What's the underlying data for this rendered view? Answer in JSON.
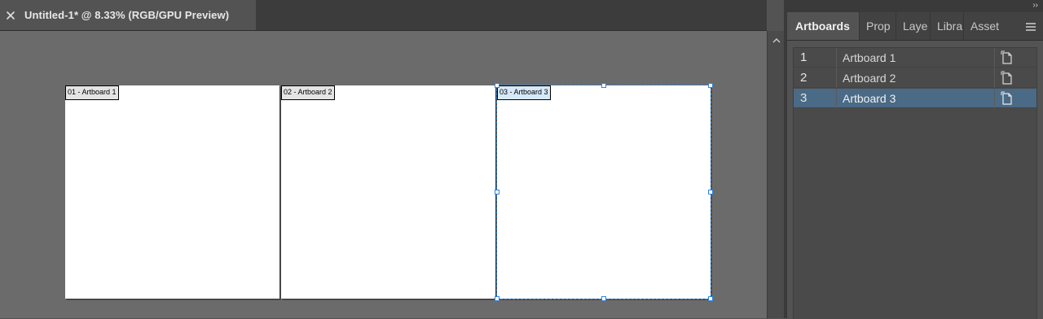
{
  "document": {
    "tab_title": "Untitled-1* @ 8.33% (RGB/GPU Preview)",
    "zoom": "8.33%",
    "color_mode": "RGB/GPU Preview"
  },
  "canvas": {
    "artboards": [
      {
        "label": "01 - Artboard 1",
        "selected": false
      },
      {
        "label": "02 - Artboard 2",
        "selected": false
      },
      {
        "label": "03 - Artboard 3",
        "selected": true
      }
    ],
    "selection_color": "#2f86de"
  },
  "panel": {
    "collapse_glyph": "››",
    "tabs": [
      "Artboards",
      "Prop",
      "Laye",
      "Libra",
      "Asset"
    ],
    "active_tab": "Artboards",
    "rows": [
      {
        "number": "1",
        "name": "Artboard 1",
        "selected": false
      },
      {
        "number": "2",
        "name": "Artboard 2",
        "selected": false
      },
      {
        "number": "3",
        "name": "Artboard 3",
        "selected": true
      }
    ],
    "selected_row_color": "#4a6a86",
    "icons": {
      "close": "close-icon",
      "menu": "hamburger-menu-icon",
      "artboard_options": "artboard-options-icon",
      "scroll_up": "chevron-up-icon"
    }
  }
}
